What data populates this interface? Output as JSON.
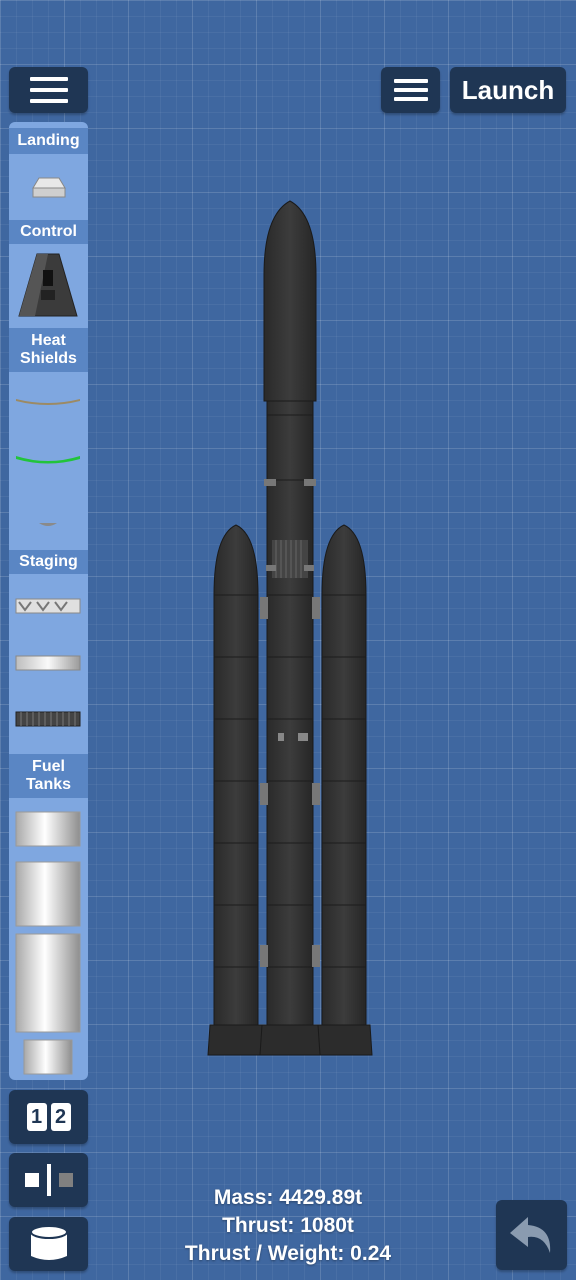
{
  "toolbar": {
    "launch_label": "Launch"
  },
  "palette": {
    "categories": {
      "landing": "Landing",
      "control": "Control",
      "heat_shields_1": "Heat",
      "heat_shields_2": "Shields",
      "staging": "Staging",
      "fuel_tanks_1": "Fuel",
      "fuel_tanks_2": "Tanks"
    }
  },
  "bottom_tools": {
    "stage_1": "1",
    "stage_2": "2"
  },
  "stats": {
    "mass": "Mass: 4429.89t",
    "thrust": "Thrust: 1080t",
    "twr": "Thrust / Weight: 0.24"
  },
  "icons": [
    "menu-icon",
    "launch-button",
    "undo-icon",
    "fuel-tank-icon",
    "symmetry-icon",
    "stage-numbers-icon"
  ]
}
